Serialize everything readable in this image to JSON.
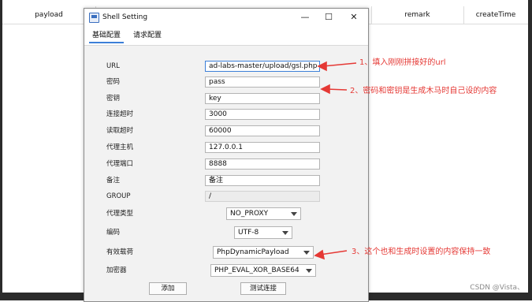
{
  "background": {
    "columns": [
      "payload",
      "",
      "remark",
      "createTime"
    ]
  },
  "dialog": {
    "title": "Shell Setting",
    "window_buttons": {
      "minimize": "—",
      "maximize": "☐",
      "close": "✕"
    },
    "tabs": [
      {
        "label": "基础配置",
        "active": true
      },
      {
        "label": "请求配置",
        "active": false
      }
    ],
    "fields": {
      "url": {
        "label": "URL",
        "value": "ad-labs-master/upload/gsl.php"
      },
      "password": {
        "label": "密码",
        "value": "pass"
      },
      "key": {
        "label": "密钥",
        "value": "key"
      },
      "connect_timeout": {
        "label": "连接超时",
        "value": "3000"
      },
      "read_timeout": {
        "label": "读取超时",
        "value": "60000"
      },
      "proxy_host": {
        "label": "代理主机",
        "value": "127.0.0.1"
      },
      "proxy_port": {
        "label": "代理端口",
        "value": "8888"
      },
      "remark": {
        "label": "备注",
        "value": "备注"
      },
      "group": {
        "label": "GROUP",
        "value": "/"
      }
    },
    "selects": {
      "proxy_type": {
        "label": "代理类型",
        "value": "NO_PROXY"
      },
      "encoding": {
        "label": "编码",
        "value": "UTF-8"
      },
      "payload": {
        "label": "有效载荷",
        "value": "PhpDynamicPayload"
      },
      "encryptor": {
        "label": "加密器",
        "value": "PHP_EVAL_XOR_BASE64"
      }
    },
    "buttons": {
      "add": "添加",
      "test": "测试连接"
    }
  },
  "annotations": {
    "note1": "1、填入刚刚拼接好的url",
    "note2": "2、密码和密钥是生成木马时自己设的内容",
    "note3": "3、这个也和生成时设置的内容保持一致",
    "arrow_color": "#e53935"
  },
  "watermark": "CSDN @Vista、"
}
